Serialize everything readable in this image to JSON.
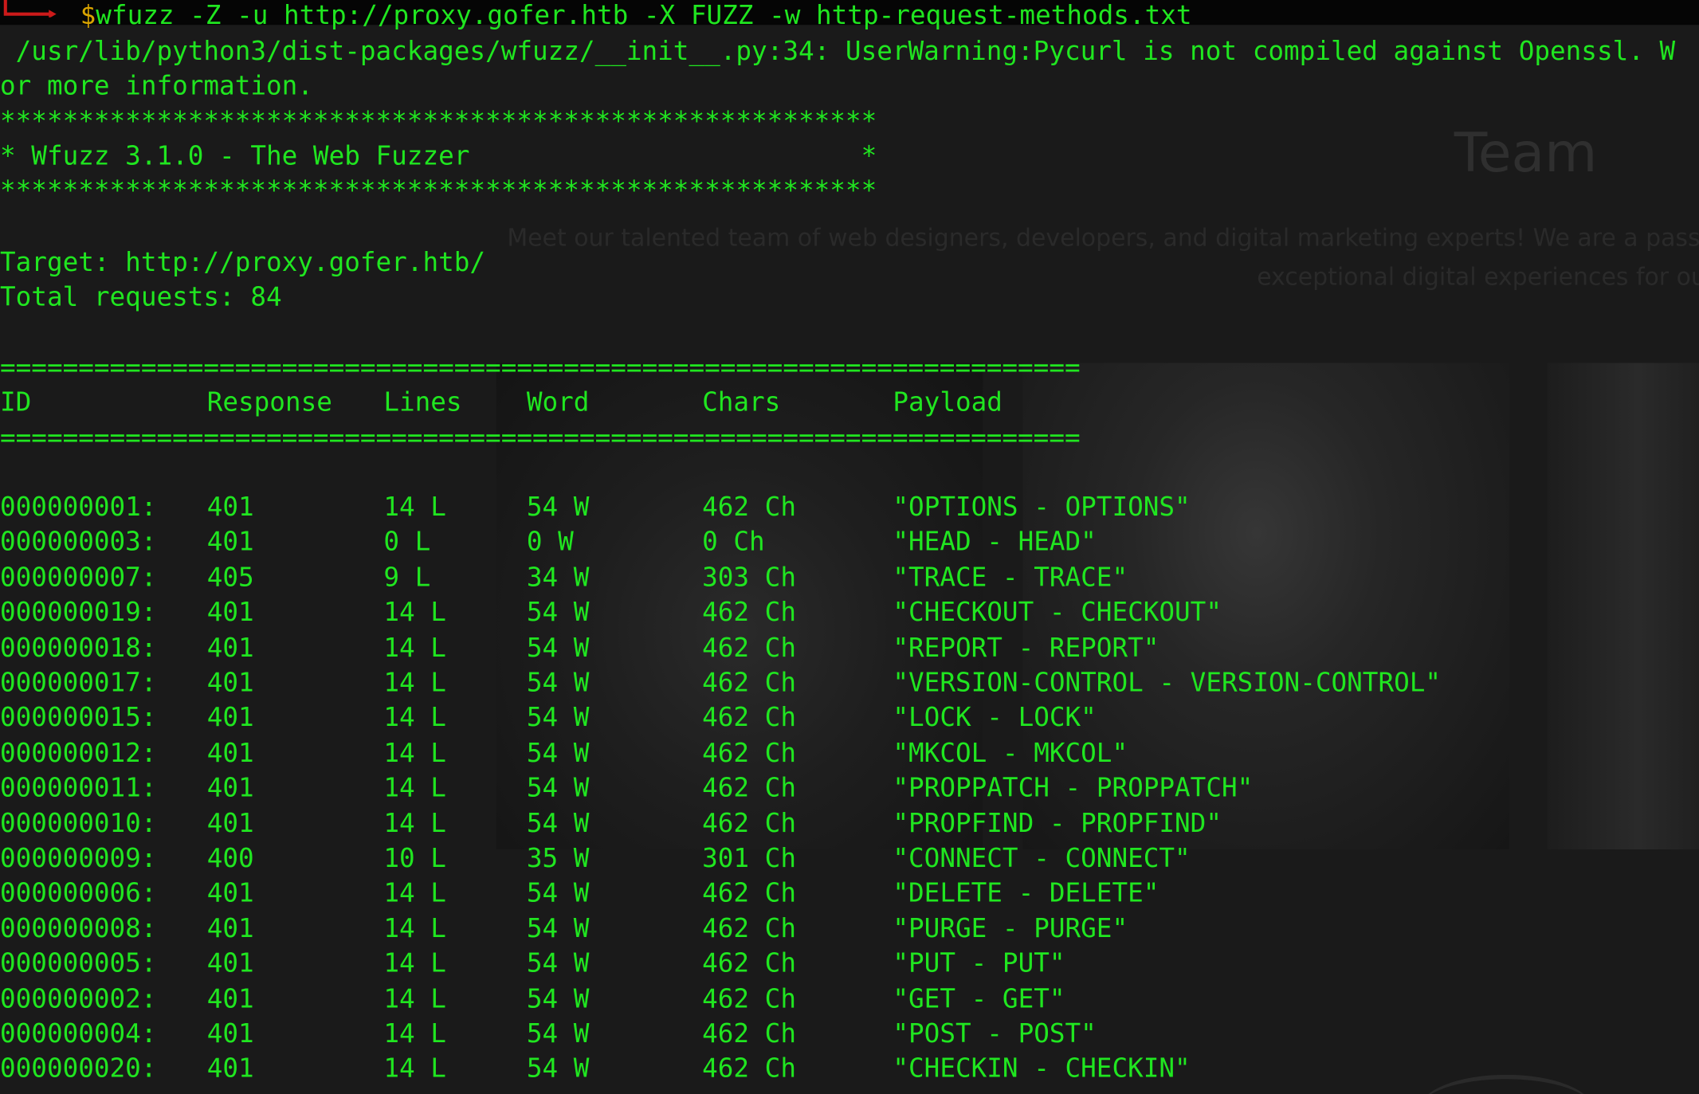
{
  "background_page": {
    "section_title": "Team",
    "description_line1": "Meet our talented team of web designers, developers, and digital marketing experts! We are a passio",
    "description_line2": "exceptional digital experiences for ou"
  },
  "terminal": {
    "prompt_symbol": "$",
    "command": "wfuzz -Z -u http://proxy.gofer.htb -X FUZZ -w http-request-methods.txt",
    "warning_line1": " /usr/lib/python3/dist-packages/wfuzz/__init__.py:34: UserWarning:Pycurl is not compiled against Openssl. W",
    "warning_line2": "or more information.",
    "banner_border": "********************************************************",
    "banner_text": "* Wfuzz 3.1.0 - The Web Fuzzer                         *",
    "target_line": "Target: http://proxy.gofer.htb/",
    "total_requests_line": "Total requests: 84",
    "separator": "=====================================================================",
    "headers": {
      "id": "ID",
      "response": "Response",
      "lines": "Lines",
      "word": "Word",
      "chars": "Chars",
      "payload": "Payload"
    },
    "rows": [
      {
        "id": "000000001:",
        "response": "401",
        "lines": "14 L",
        "word": "54 W",
        "chars": "462 Ch",
        "payload": "\"OPTIONS - OPTIONS\""
      },
      {
        "id": "000000003:",
        "response": "401",
        "lines": "0 L",
        "word": "0 W",
        "chars": "0 Ch",
        "payload": "\"HEAD - HEAD\""
      },
      {
        "id": "000000007:",
        "response": "405",
        "lines": "9 L",
        "word": "34 W",
        "chars": "303 Ch",
        "payload": "\"TRACE - TRACE\""
      },
      {
        "id": "000000019:",
        "response": "401",
        "lines": "14 L",
        "word": "54 W",
        "chars": "462 Ch",
        "payload": "\"CHECKOUT - CHECKOUT\""
      },
      {
        "id": "000000018:",
        "response": "401",
        "lines": "14 L",
        "word": "54 W",
        "chars": "462 Ch",
        "payload": "\"REPORT - REPORT\""
      },
      {
        "id": "000000017:",
        "response": "401",
        "lines": "14 L",
        "word": "54 W",
        "chars": "462 Ch",
        "payload": "\"VERSION-CONTROL - VERSION-CONTROL\""
      },
      {
        "id": "000000015:",
        "response": "401",
        "lines": "14 L",
        "word": "54 W",
        "chars": "462 Ch",
        "payload": "\"LOCK - LOCK\""
      },
      {
        "id": "000000012:",
        "response": "401",
        "lines": "14 L",
        "word": "54 W",
        "chars": "462 Ch",
        "payload": "\"MKCOL - MKCOL\""
      },
      {
        "id": "000000011:",
        "response": "401",
        "lines": "14 L",
        "word": "54 W",
        "chars": "462 Ch",
        "payload": "\"PROPPATCH - PROPPATCH\""
      },
      {
        "id": "000000010:",
        "response": "401",
        "lines": "14 L",
        "word": "54 W",
        "chars": "462 Ch",
        "payload": "\"PROPFIND - PROPFIND\""
      },
      {
        "id": "000000009:",
        "response": "400",
        "lines": "10 L",
        "word": "35 W",
        "chars": "301 Ch",
        "payload": "\"CONNECT - CONNECT\""
      },
      {
        "id": "000000006:",
        "response": "401",
        "lines": "14 L",
        "word": "54 W",
        "chars": "462 Ch",
        "payload": "\"DELETE - DELETE\""
      },
      {
        "id": "000000008:",
        "response": "401",
        "lines": "14 L",
        "word": "54 W",
        "chars": "462 Ch",
        "payload": "\"PURGE - PURGE\""
      },
      {
        "id": "000000005:",
        "response": "401",
        "lines": "14 L",
        "word": "54 W",
        "chars": "462 Ch",
        "payload": "\"PUT - PUT\""
      },
      {
        "id": "000000002:",
        "response": "401",
        "lines": "14 L",
        "word": "54 W",
        "chars": "462 Ch",
        "payload": "\"GET - GET\""
      },
      {
        "id": "000000004:",
        "response": "401",
        "lines": "14 L",
        "word": "54 W",
        "chars": "462 Ch",
        "payload": "\"POST - POST\""
      },
      {
        "id": "000000020:",
        "response": "401",
        "lines": "14 L",
        "word": "54 W",
        "chars": "462 Ch",
        "payload": "\"CHECKIN - CHECKIN\""
      }
    ]
  },
  "colors": {
    "terminal_text": "#20e620",
    "prompt_dollar": "#d9a400",
    "prompt_arrow": "#cc1a1a",
    "background": "#1a1a1a"
  }
}
